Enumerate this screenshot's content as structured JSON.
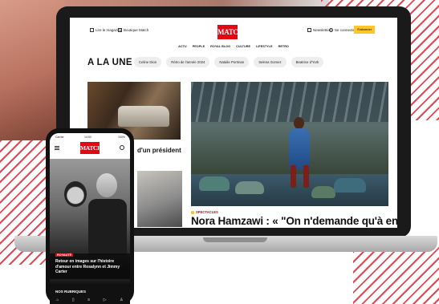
{
  "colors": {
    "brand_red": "#e30613",
    "accent_yellow": "#ffc629",
    "stripe_red": "#e0343f"
  },
  "laptop_site": {
    "topbar": {
      "left_links": [
        "Lire le magazine",
        "Boutique Match"
      ],
      "logo": "MATCH",
      "right_links": [
        "Newsletters",
        "Se connecter"
      ],
      "subscribe_label": "S'abonner"
    },
    "nav": [
      "ACTU",
      "PEOPLE",
      "ROYAL BLOG",
      "CULTURE",
      "LIFESTYLE",
      "RETRO"
    ],
    "section_heading": "A LA UNE",
    "topic_pills": [
      "Celine Dion",
      "Rétro de l'année 2024",
      "Natalie Portman",
      "Selena Gomez",
      "Beatrice d'York"
    ],
    "left_story_title": "d'un président",
    "hero": {
      "category": "SPECTACLES",
      "title": "Nora Hamzawi : « \"On n'demande qu'à en"
    }
  },
  "phone_app": {
    "status_bar": {
      "carrier": "Carrier",
      "time": "14:00",
      "battery": "100%"
    },
    "logo": "MATCH",
    "story": {
      "category": "ROYAUTÉ",
      "title": "Retour en images sur l'histoire d'amour entre Rosalynn et Jimmy Carter"
    },
    "rubriques_label": "NOS RUBRIQUES",
    "tabbar_icons": [
      "home-icon",
      "bookmark-icon",
      "menu-icon",
      "play-icon",
      "user-icon"
    ]
  }
}
